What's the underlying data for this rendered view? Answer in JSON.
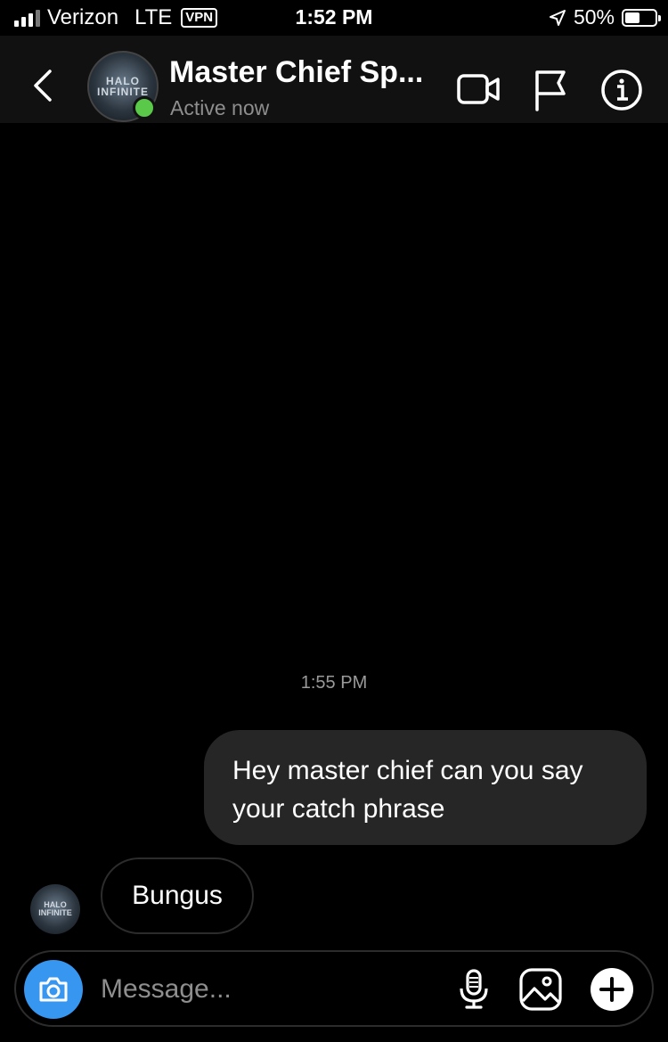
{
  "status_bar": {
    "carrier": "Verizon",
    "network": "LTE",
    "vpn": "VPN",
    "time": "1:52 PM",
    "battery_percent": "50%",
    "battery_level": 0.5
  },
  "header": {
    "title": "Master Chief Sp...",
    "status": "Active now",
    "avatar_text": "HALO INFINITE"
  },
  "conversation": {
    "timestamp": "1:55 PM",
    "messages": [
      {
        "direction": "outgoing",
        "text": "Hey master chief can you say your catch phrase"
      },
      {
        "direction": "incoming",
        "text": "Bungus"
      }
    ]
  },
  "composer": {
    "placeholder": "Message..."
  },
  "colors": {
    "background": "#000000",
    "header_bg": "#111111",
    "outgoing_bubble": "#262626",
    "camera_button": "#3797f0",
    "online_dot": "#5ac94a"
  },
  "icons": [
    "back-chevron-icon",
    "video-call-icon",
    "flag-icon",
    "info-icon",
    "camera-icon",
    "microphone-icon",
    "gallery-icon",
    "plus-icon",
    "location-arrow-icon"
  ]
}
